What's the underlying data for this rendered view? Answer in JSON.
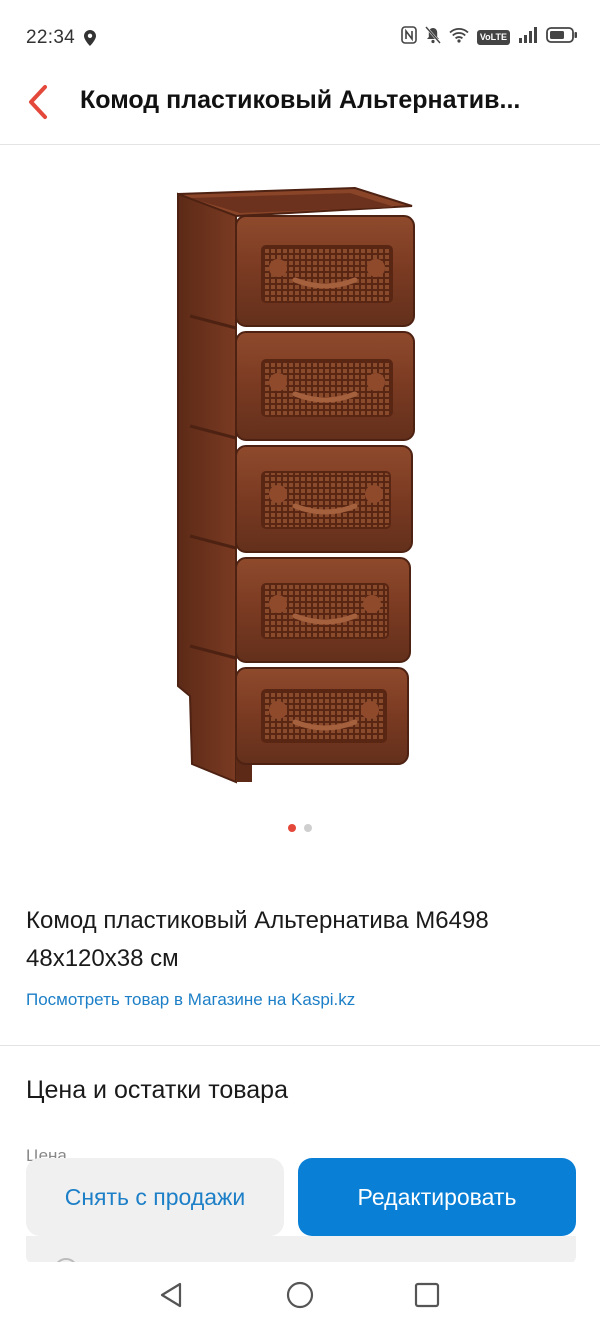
{
  "status_bar": {
    "time": "22:34",
    "network_badge": "VoLTE",
    "icons": [
      "location-icon",
      "nfc-icon",
      "mute-icon",
      "wifi-icon",
      "signal-icon",
      "battery-icon"
    ]
  },
  "app_bar": {
    "back_icon": "chevron-left-icon",
    "title": "Комод пластиковый Альтернатив..."
  },
  "product": {
    "image_alt": "Комод пластиковый коричневый",
    "gallery": {
      "total": 2,
      "active": 1
    },
    "name": "Комод пластиковый Альтернатива М6498 48х120х38 см",
    "store_link": "Посмотреть товар в Магазине на Kaspi.kz"
  },
  "price_section": {
    "title": "Цена и остатки товара",
    "price_label": "Цена"
  },
  "actions": {
    "remove_label": "Снять с продажи",
    "edit_label": "Редактировать"
  },
  "colors": {
    "accent_red": "#e4483a",
    "link_blue": "#1c7fc7",
    "primary_button": "#0a7fd6",
    "secondary_button": "#f0f0f0",
    "product_brown": "#7a3a22"
  },
  "nav_bar": {
    "icons": [
      "back-triangle-icon",
      "home-circle-icon",
      "recents-square-icon"
    ]
  }
}
